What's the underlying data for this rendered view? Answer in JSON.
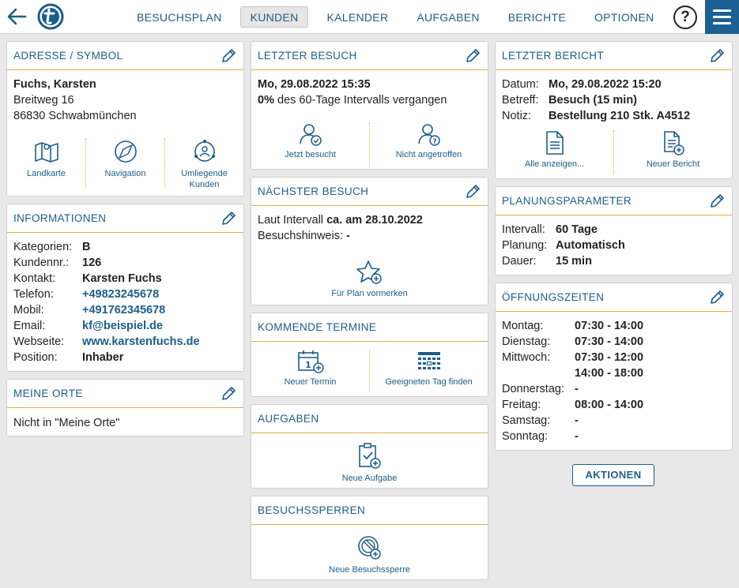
{
  "nav": {
    "items": [
      "BESUCHSPLAN",
      "KUNDEN",
      "KALENDER",
      "AUFGABEN",
      "BERICHTE",
      "OPTIONEN"
    ],
    "active": "KUNDEN",
    "help_label": "?"
  },
  "address": {
    "title": "ADRESSE / SYMBOL",
    "name": "Fuchs, Karsten",
    "street": "Breitweg 16",
    "city": "86830 Schwabmünchen",
    "actions": [
      "Landkarte",
      "Navigation",
      "Umliegende Kunden"
    ]
  },
  "info": {
    "title": "INFORMATIONEN",
    "rows": [
      {
        "label": "Kategorien:",
        "value": "B"
      },
      {
        "label": "Kundennr.:",
        "value": "126"
      },
      {
        "label": "Kontakt:",
        "value": "Karsten Fuchs"
      },
      {
        "label": "Telefon:",
        "value": "+49823245678"
      },
      {
        "label": "Mobil:",
        "value": "+491762345678"
      },
      {
        "label": "Email:",
        "value": "kf@beispiel.de"
      },
      {
        "label": "Webseite:",
        "value": "www.karstenfuchs.de"
      },
      {
        "label": "Position:",
        "value": "Inhaber"
      }
    ]
  },
  "places": {
    "title": "MEINE ORTE",
    "text": "Nicht in \"Meine Orte\""
  },
  "last_visit": {
    "title": "LETZTER BESUCH",
    "date": "Mo, 29.08.2022 15:35",
    "percent": "0%",
    "interval_text": " des 60-Tage Intervalls vergangen",
    "actions": [
      "Jetzt besucht",
      "Nicht angetroffen"
    ]
  },
  "next_visit": {
    "title": "NÄCHSTER BESUCH",
    "line1_prefix": "Laut Intervall ",
    "line1_value": "ca. am 28.10.2022",
    "line2_prefix": "Besuchshinweis: ",
    "line2_value": "-",
    "action": "Für Plan vormerken"
  },
  "appointments": {
    "title": "KOMMENDE TERMINE",
    "actions": [
      "Neuer Termin",
      "Geeigneten Tag finden"
    ]
  },
  "tasks": {
    "title": "AUFGABEN",
    "action": "Neue Aufgabe"
  },
  "blocks": {
    "title": "BESUCHSSPERREN",
    "action": "Neue Besuchssperre"
  },
  "last_report": {
    "title": "LETZTER BERICHT",
    "rows": [
      {
        "label": "Datum:",
        "value": "Mo, 29.08.2022 15:20"
      },
      {
        "label": "Betreff:",
        "value": "Besuch (15 min)"
      },
      {
        "label": "Notiz:",
        "value": "Bestellung 210 Stk. A4512"
      }
    ],
    "actions": [
      "Alle anzeigen...",
      "Neuer Bericht"
    ]
  },
  "planning": {
    "title": "PLANUNGSPARAMETER",
    "rows": [
      {
        "label": "Intervall:",
        "value": "60 Tage"
      },
      {
        "label": "Planung:",
        "value": "Automatisch"
      },
      {
        "label": "Dauer:",
        "value": "15 min"
      }
    ]
  },
  "hours": {
    "title": "ÖFFNUNGSZEITEN",
    "rows": [
      {
        "label": "Montag:",
        "value": "07:30 - 14:00"
      },
      {
        "label": "Dienstag:",
        "value": "07:30 - 14:00"
      },
      {
        "label": "Mittwoch:",
        "value": "07:30 - 12:00"
      },
      {
        "label": "",
        "value": "14:00 - 18:00"
      },
      {
        "label": "Donnerstag:",
        "value": "-"
      },
      {
        "label": "Freitag:",
        "value": "08:00 - 14:00"
      },
      {
        "label": "Samstag:",
        "value": "-"
      },
      {
        "label": "Sonntag:",
        "value": "-"
      }
    ]
  },
  "actions_button": "AKTIONEN"
}
